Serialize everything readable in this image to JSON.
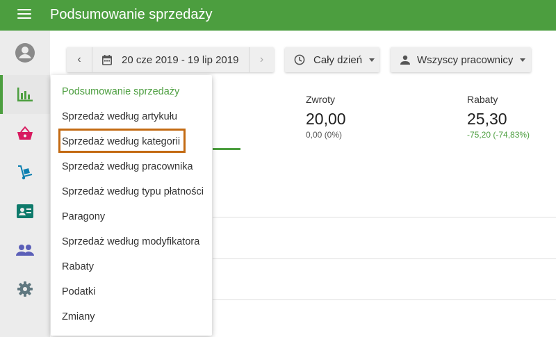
{
  "header": {
    "title": "Podsumowanie sprzedaży"
  },
  "toolbar": {
    "date_range": "20 cze 2019 - 19 lip 2019",
    "time_filter": "Cały dzień",
    "employee_filter": "Wszyscy pracownicy"
  },
  "stats": [
    {
      "label": "Zwroty",
      "value": "20,00",
      "change": "0,00 (0%)"
    },
    {
      "label": "Rabaty",
      "value": "25,30",
      "change": "-75,20 (-74,83%)"
    }
  ],
  "menu": {
    "items": [
      "Podsumowanie sprzedaży",
      "Sprzedaż według artykułu",
      "Sprzedaż według kategorii",
      "Sprzedaż według pracownika",
      "Sprzedaż według typu płatności",
      "Paragony",
      "Sprzedaż według modyfikatora",
      "Rabaty",
      "Podatki",
      "Zmiany"
    ],
    "active_index": 0,
    "highlighted_index": 2
  },
  "colors": {
    "primary": "#4c9e3f",
    "highlight_border": "#c36a12",
    "cart_icon": "#d81b60",
    "nav_icon": "#0e7a6b"
  }
}
